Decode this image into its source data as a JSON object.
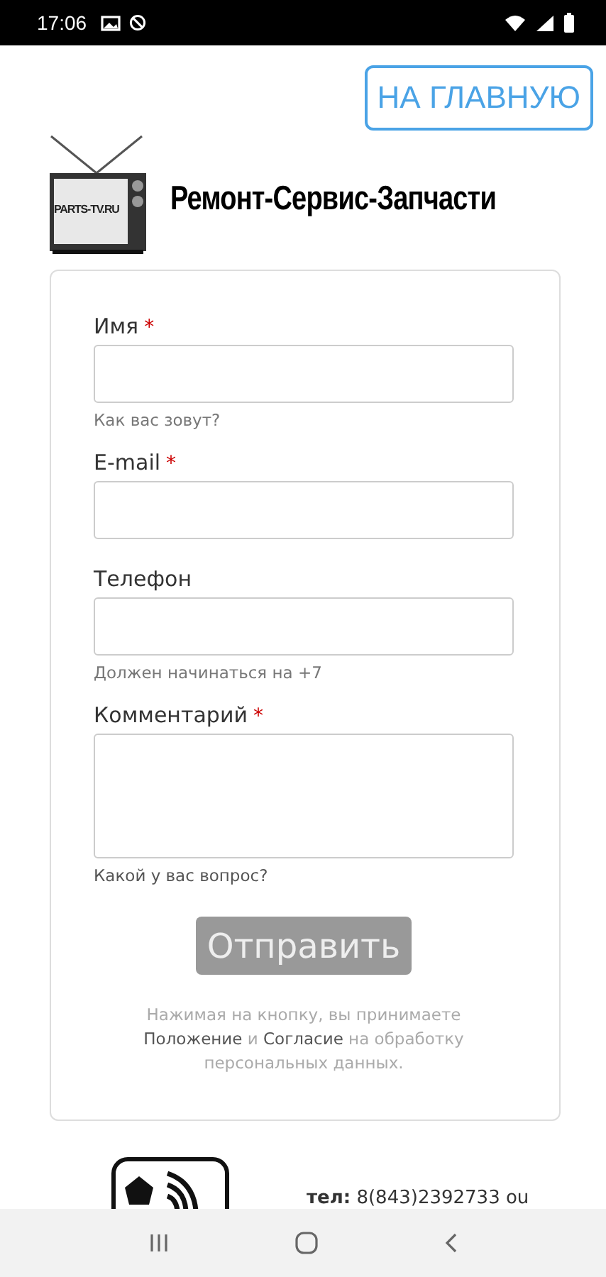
{
  "status_bar": {
    "time": "17:06"
  },
  "home_button": "НА ГЛАВНУЮ",
  "logo": {
    "screen_text": "PARTS-TV.RU",
    "title": "Ремонт-Сервис-Запчасти"
  },
  "form": {
    "fields": [
      {
        "kind": "input",
        "label": "Имя",
        "required_mark": "*",
        "hint": "Как вас зовут?"
      },
      {
        "kind": "input",
        "label": "E-mail",
        "required_mark": "*"
      },
      {
        "kind": "input",
        "label": "Телефон",
        "hint": "Должен начинаться на +7"
      },
      {
        "kind": "textarea",
        "label": "Комментарий",
        "required_mark": "*",
        "hint": "Какой у вас вопрос?"
      }
    ],
    "submit": {
      "label": "Отправить",
      "disabled": true
    },
    "consent": "Нажимая на кнопку, вы принимаете **Положение** и **Согласие** на обработку персональных данных."
  },
  "footer": {
    "phone_label": "тел:",
    "phone": "8(843)2392733 ou"
  }
}
